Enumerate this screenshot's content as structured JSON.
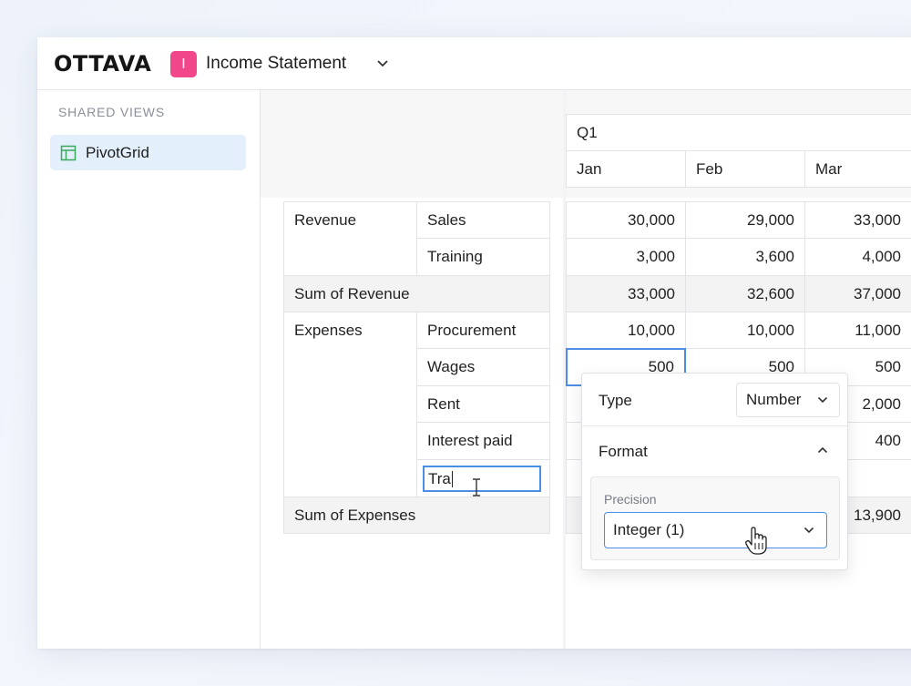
{
  "app": {
    "logo": "OTTAVA",
    "document": {
      "badge": "I",
      "title": "Income Statement",
      "badge_color": "#f2468a"
    }
  },
  "sidebar": {
    "heading": "SHARED VIEWS",
    "items": [
      {
        "label": "PivotGrid",
        "icon": "table-icon",
        "selected": true
      }
    ]
  },
  "grid": {
    "column_group": "Q1",
    "columns": [
      "Jan",
      "Feb",
      "Mar"
    ],
    "rows": [
      {
        "group": "Revenue",
        "item": "Sales",
        "values": [
          "30,000",
          "29,000",
          "33,000"
        ]
      },
      {
        "group": "",
        "item": "Training",
        "values": [
          "3,000",
          "3,600",
          "4,000"
        ]
      },
      {
        "sum_label": "Sum of Revenue",
        "values": [
          "33,000",
          "32,600",
          "37,000"
        ]
      },
      {
        "group": "Expenses",
        "item": "Procurement",
        "values": [
          "10,000",
          "10,000",
          "11,000"
        ]
      },
      {
        "group": "",
        "item": "Wages",
        "values": [
          "500",
          "500",
          "500"
        ]
      },
      {
        "group": "",
        "item": "Rent",
        "values": [
          "",
          "",
          "2,000"
        ]
      },
      {
        "group": "",
        "item": "Interest paid",
        "values": [
          "",
          "",
          "400"
        ]
      },
      {
        "group": "",
        "item_editing": "Tra",
        "values": [
          "",
          "",
          ""
        ]
      },
      {
        "sum_label": "Sum of Expenses",
        "values": [
          "",
          "",
          "13,900"
        ]
      }
    ]
  },
  "popover": {
    "type_label": "Type",
    "type_value": "Number",
    "format_label": "Format",
    "precision_label": "Precision",
    "precision_value": "Integer (1)"
  },
  "colors": {
    "accent": "#4c8ee6",
    "sidebar_selected": "#e3f0fb",
    "icon_green": "#3aa95e"
  }
}
